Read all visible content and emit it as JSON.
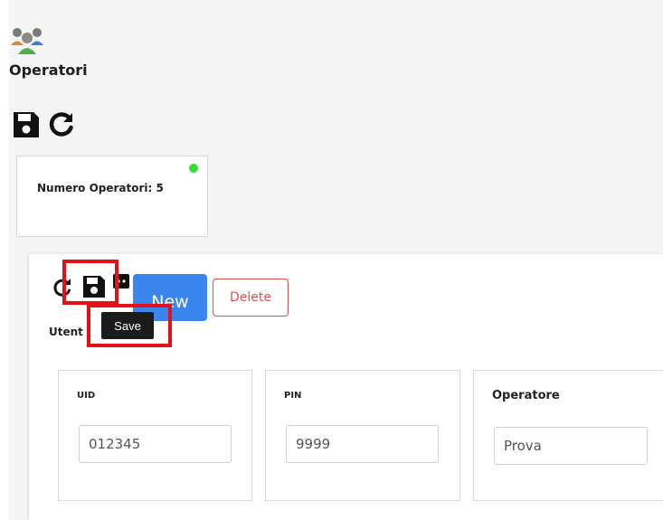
{
  "header": {
    "app_icon": "users-group-icon",
    "title": "Operatori",
    "toolbar": {
      "save_icon": "floppy-save-icon",
      "refresh_icon": "refresh-icon"
    }
  },
  "summary_card": {
    "label": "Numero Operatori: 5",
    "status_color": "#33dd33"
  },
  "panel": {
    "toolbar": {
      "refresh_icon": "refresh-icon",
      "save_icon": "floppy-save-icon",
      "more_icon": "more-icon",
      "tooltip": "Save",
      "new_label": "New",
      "delete_label": "Delete"
    },
    "section_label": "Utent",
    "fields": [
      {
        "label": "UID",
        "value": "012345"
      },
      {
        "label": "PIN",
        "value": "9999"
      },
      {
        "label": "Operatore",
        "value": "Prova"
      }
    ]
  },
  "colors": {
    "primary": "#3a85ee",
    "danger": "#d9534f",
    "highlight": "#e3101a",
    "tooltip_bg": "#1b1b1b"
  }
}
